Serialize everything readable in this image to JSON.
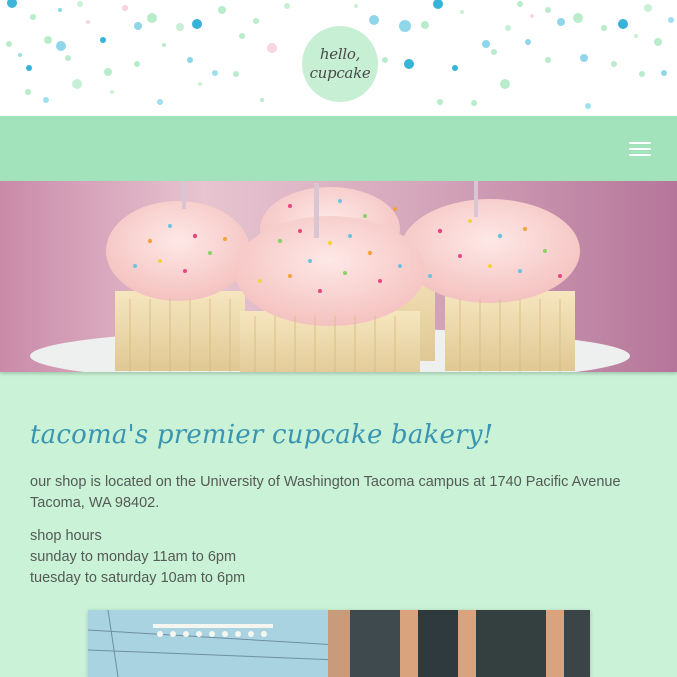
{
  "logo": {
    "line1": "hello,",
    "line2": "cupcake"
  },
  "nav": {
    "menu_icon": "hamburger-menu-icon"
  },
  "hero": {
    "image": "cupcakes-with-sprinkles"
  },
  "main": {
    "headline": "tacoma's premier cupcake bakery!",
    "location_line1": "our shop is located on the University of Washington Tacoma campus at 1740 Pacific Avenue",
    "location_line2": "Tacoma, WA 98402.",
    "hours_title": "shop hours",
    "hours": [
      "sunday to monday 11am to 6pm",
      "tuesday to saturday 10am to 6pm"
    ]
  },
  "storefront": {
    "image": "bakery-storefront-photo"
  },
  "colors": {
    "page_bg": "#c9f2d6",
    "nav_bg": "#a3e3bb",
    "headline": "#3a95b2",
    "body_text": "#555a56",
    "logo_bg": "#c7efd4"
  }
}
